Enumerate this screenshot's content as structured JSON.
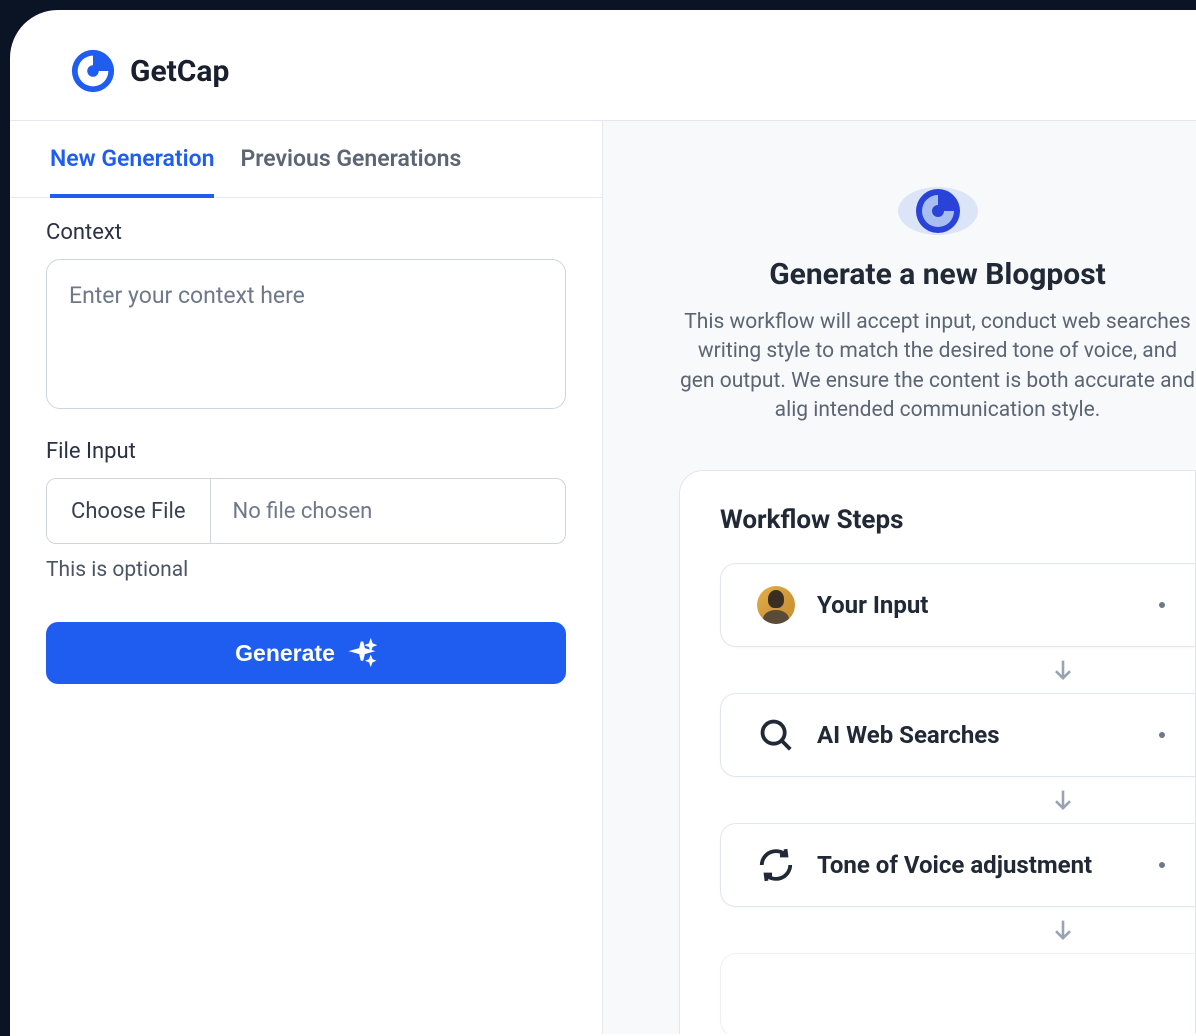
{
  "brand": "GetCap",
  "tabs": {
    "new": "New Generation",
    "previous": "Previous Generations"
  },
  "form": {
    "context_label": "Context",
    "context_placeholder": "Enter your context here",
    "file_label": "File Input",
    "choose_file": "Choose File",
    "file_status": "No file chosen",
    "file_hint": "This is optional",
    "generate": "Generate"
  },
  "hero": {
    "title": "Generate a new Blogpost",
    "description": "This workflow will accept input, conduct web searches writing style to match the desired tone of voice, and gen output. We ensure the content is both accurate and alig intended communication style."
  },
  "workflow": {
    "title": "Workflow Steps",
    "steps": [
      {
        "label": "Your Input"
      },
      {
        "label": "AI Web Searches"
      },
      {
        "label": "Tone of Voice adjustment"
      }
    ]
  },
  "icons": {
    "logo": "getcap-logo",
    "sparkle": "sparkle-icon",
    "avatar": "user-avatar",
    "search": "search-icon",
    "refresh": "refresh-icon",
    "arrow_down": "arrow-down-icon"
  }
}
